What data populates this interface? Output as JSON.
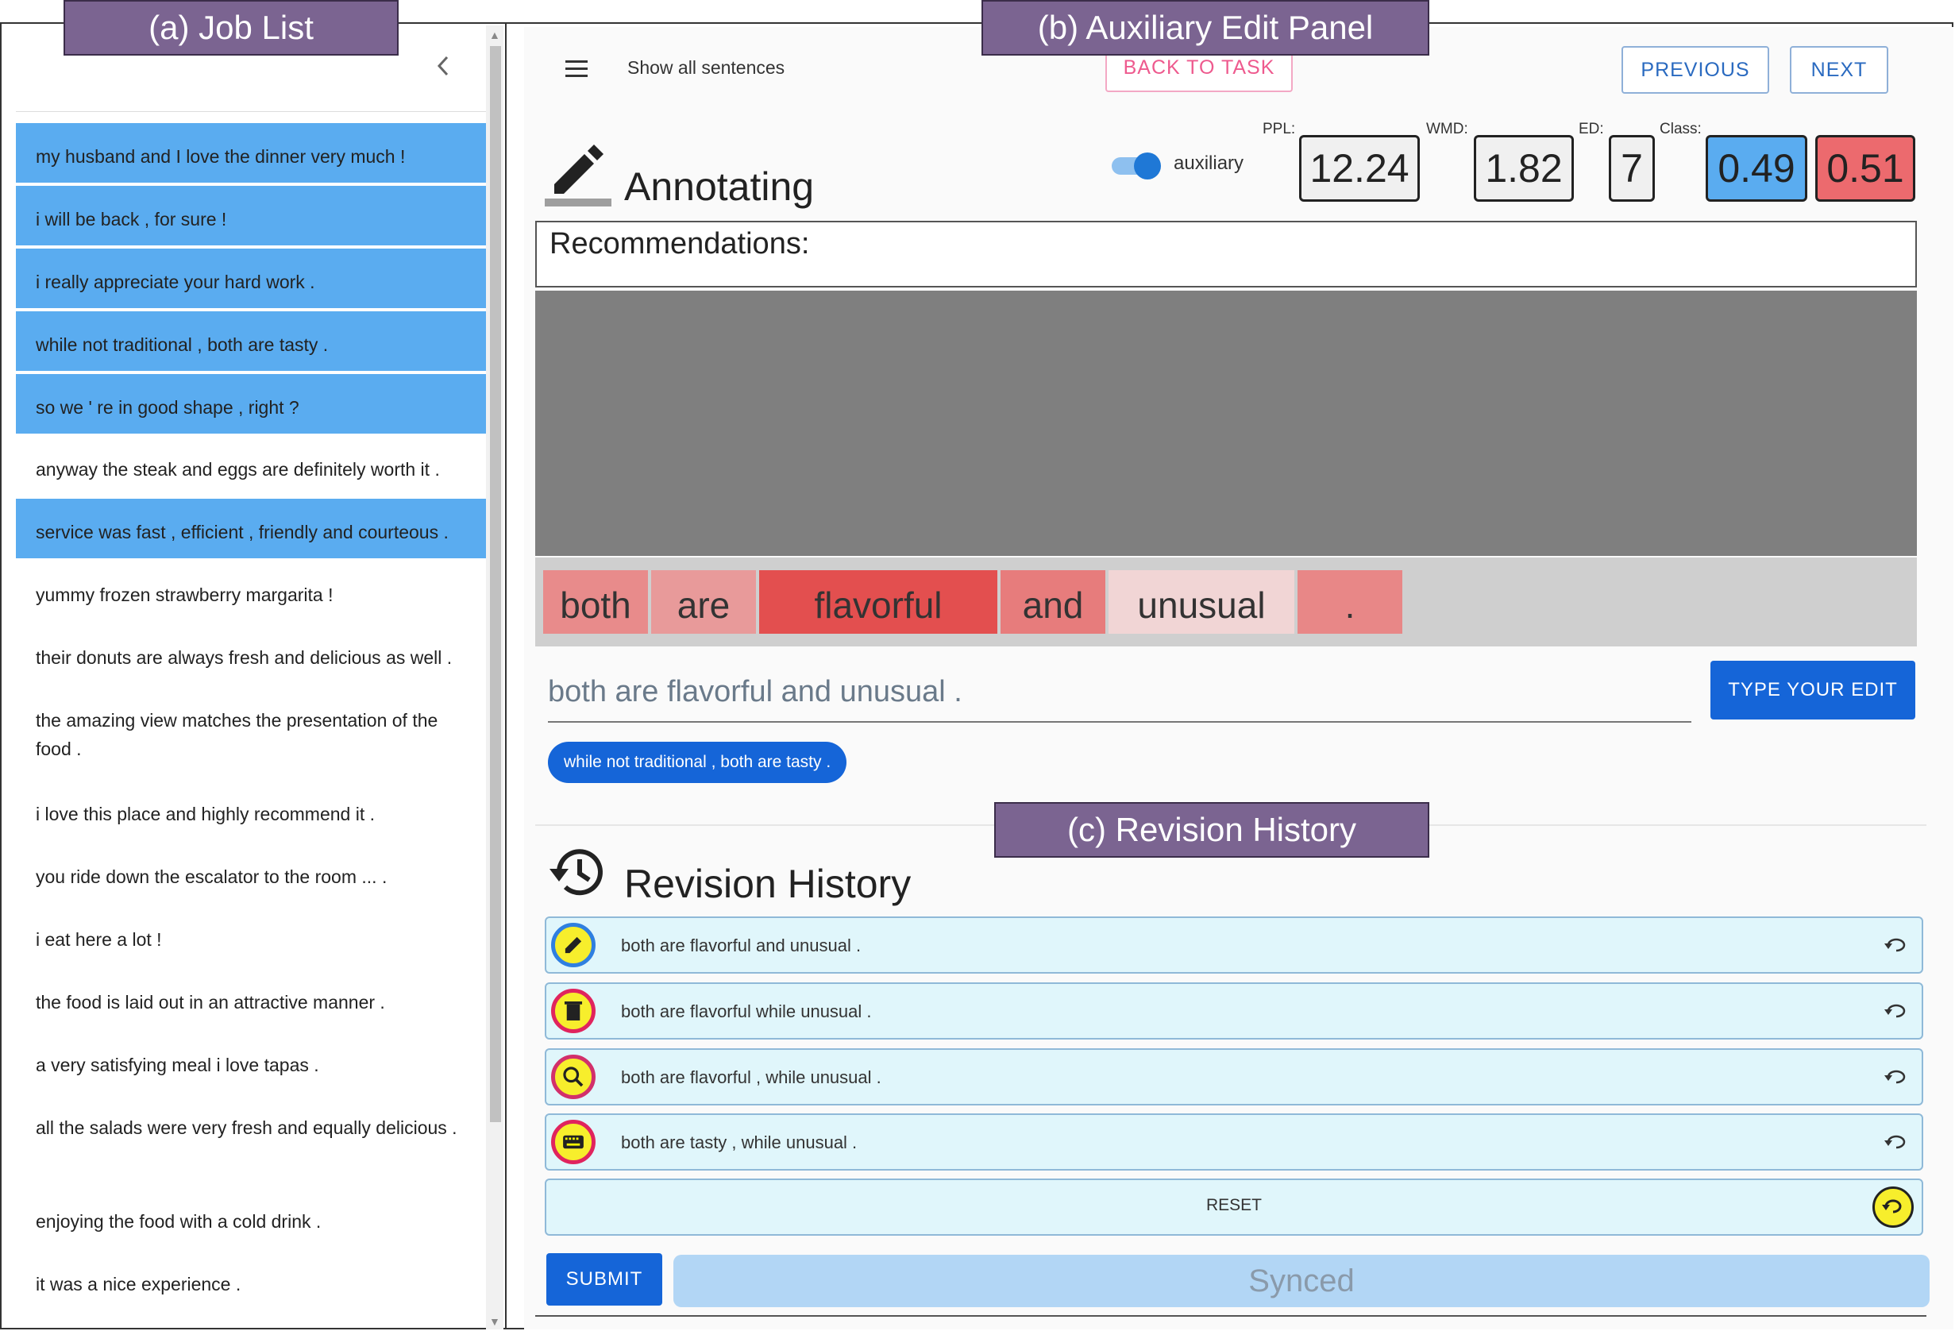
{
  "captions": {
    "job_list": "(a) Job List",
    "edit_panel": "(b) Auxiliary Edit Panel",
    "revision_history": "(c) Revision History"
  },
  "job_list": {
    "collapse_icon": "chevron-left-icon",
    "items": [
      {
        "text": "my husband and I love the dinner very much !",
        "selected": true
      },
      {
        "text": "i will be back , for sure !",
        "selected": true
      },
      {
        "text": "i really appreciate your hard work .",
        "selected": true
      },
      {
        "text": "while not traditional , both are tasty .",
        "selected": true
      },
      {
        "text": "so we ' re in good shape , right ?",
        "selected": true
      },
      {
        "text": "anyway the steak and eggs are definitely worth it .",
        "selected": false
      },
      {
        "text": "service was fast , efficient , friendly and courteous .",
        "selected": true
      },
      {
        "text": "yummy frozen strawberry margarita !",
        "selected": false
      },
      {
        "text": "their donuts are always fresh and delicious as well .",
        "selected": false
      },
      {
        "text": "the amazing view matches the presentation of the food .",
        "selected": false
      },
      {
        "text": "i love this place and highly recommend it .",
        "selected": false
      },
      {
        "text": "you ride down the escalator to the room ... .",
        "selected": false
      },
      {
        "text": "i eat here a lot !",
        "selected": false
      },
      {
        "text": "the food is laid out in an attractive manner .",
        "selected": false
      },
      {
        "text": "a very satisfying meal i love tapas .",
        "selected": false
      },
      {
        "text": "all the salads were very fresh and equally delicious .",
        "selected": false
      },
      {
        "text": "enjoying the food with a cold drink .",
        "selected": false
      },
      {
        "text": "it was a nice experience .",
        "selected": false
      }
    ]
  },
  "toolbar": {
    "menu_icon": "hamburger-menu-icon",
    "show_all": "Show all sentences",
    "back_to_task": "BACK TO TASK",
    "previous": "PREVIOUS",
    "next": "NEXT"
  },
  "annotating": {
    "icon": "pencil-icon",
    "title": "Annotating",
    "toggle_label": "auxiliary",
    "toggle_on": true
  },
  "metrics": {
    "ppl_label": "PPL:",
    "ppl": "12.24",
    "wmd_label": "WMD:",
    "wmd": "1.82",
    "ed_label": "ED:",
    "ed": "7",
    "class_label": "Class:",
    "class_neg": "0.49",
    "class_pos": "0.51",
    "colors": {
      "class_neg": "#5aacf0",
      "class_pos": "#ec6a6e"
    }
  },
  "recommendations": {
    "title": "Recommendations:"
  },
  "tokens": [
    {
      "text": "both",
      "color": "#e88b8b"
    },
    {
      "text": "are",
      "color": "#e89a9a"
    },
    {
      "text": "flavorful",
      "color": "#e34f4f"
    },
    {
      "text": "and",
      "color": "#e77c7c"
    },
    {
      "text": "unusual",
      "color": "#f1d5d5"
    },
    {
      "text": ".",
      "color": "#e88787"
    }
  ],
  "edit": {
    "value": "both are flavorful and unusual .",
    "type_button": "TYPE YOUR EDIT",
    "source_chip": "while not traditional , both are tasty ."
  },
  "history": {
    "icon": "history-clock-icon",
    "title": "Revision History",
    "rows": [
      {
        "text": "both are flavorful and unusual .",
        "icon": "pencil-icon",
        "ring": "#2f7fe0"
      },
      {
        "text": "both are flavorful while unusual .",
        "icon": "trash-icon",
        "ring": "#e0245e"
      },
      {
        "text": "both are flavorful , while unusual .",
        "icon": "magnifier-icon",
        "ring": "#d2306b"
      },
      {
        "text": "both are tasty , while unusual .",
        "icon": "keyboard-icon",
        "ring": "#e0245e"
      }
    ],
    "reset": "RESET",
    "submit": "SUBMIT",
    "status": "Synced"
  }
}
